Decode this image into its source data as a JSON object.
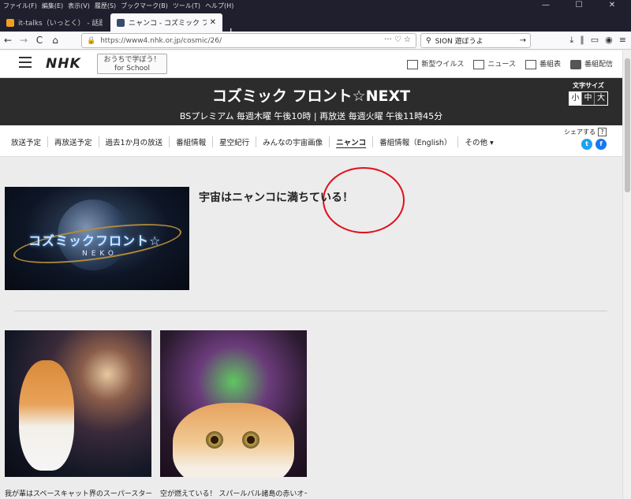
{
  "menubar": {
    "items": [
      "ファイル(F)",
      "編集(E)",
      "表示(V)",
      "履歴(S)",
      "ブックマーク(B)",
      "ツール(T)",
      "ヘルプ(H)"
    ]
  },
  "window_controls": [
    "—",
    "☐",
    "✕"
  ],
  "tabs": [
    {
      "title": "it-talks（いっとく） - 話題でつなが",
      "icon": "it-talks-favicon",
      "color": "#f0a020"
    },
    {
      "title": "ニャンコ - コズミック フロント☆NEXT",
      "icon": "nhk-favicon",
      "color": "#3a4a6a"
    }
  ],
  "newtab_label": "+",
  "nav": {
    "back": "←",
    "forward": "→",
    "reload": "C",
    "home": "⌂",
    "url": "https://www4.nhk.or.jp/cosmic/26/",
    "search_text": "SION 遊ぼうよ"
  },
  "site_header": {
    "logo": "NHK",
    "school_line1": "おうちで学ぼう！",
    "school_line2": "for School",
    "links": [
      "新型ウイルス",
      "ニュース",
      "番組表",
      "番組配信"
    ]
  },
  "banner": {
    "title": "コズミック フロント☆NEXT",
    "subtitle": "BSプレミアム 毎週木曜 午後10時 | 再放送 毎週火曜 午後11時45分",
    "fontsize_label": "文字サイズ",
    "fontsize_options": [
      "小",
      "中",
      "大"
    ]
  },
  "tabnav": {
    "items": [
      "放送予定",
      "再放送予定",
      "過去1か月の放送",
      "番組情報",
      "星空紀行",
      "みんなの宇宙画像",
      "ニャンコ",
      "番組情報（English）",
      "その他 ▾"
    ],
    "current": "ニャンコ",
    "share_label": "シェアする",
    "share_help": "?",
    "twitter": "t",
    "facebook": "f"
  },
  "hero": {
    "logo_text": "コズミックフロント☆",
    "logo_sub": "NEKO",
    "title": "宇宙はニャンコに満ちている！"
  },
  "cards": [
    {
      "caption": "我が輩はスペースキャット界のスーパースター"
    },
    {
      "caption": "空が燃えている！ スパールバル諸島の赤いオーロ"
    }
  ]
}
